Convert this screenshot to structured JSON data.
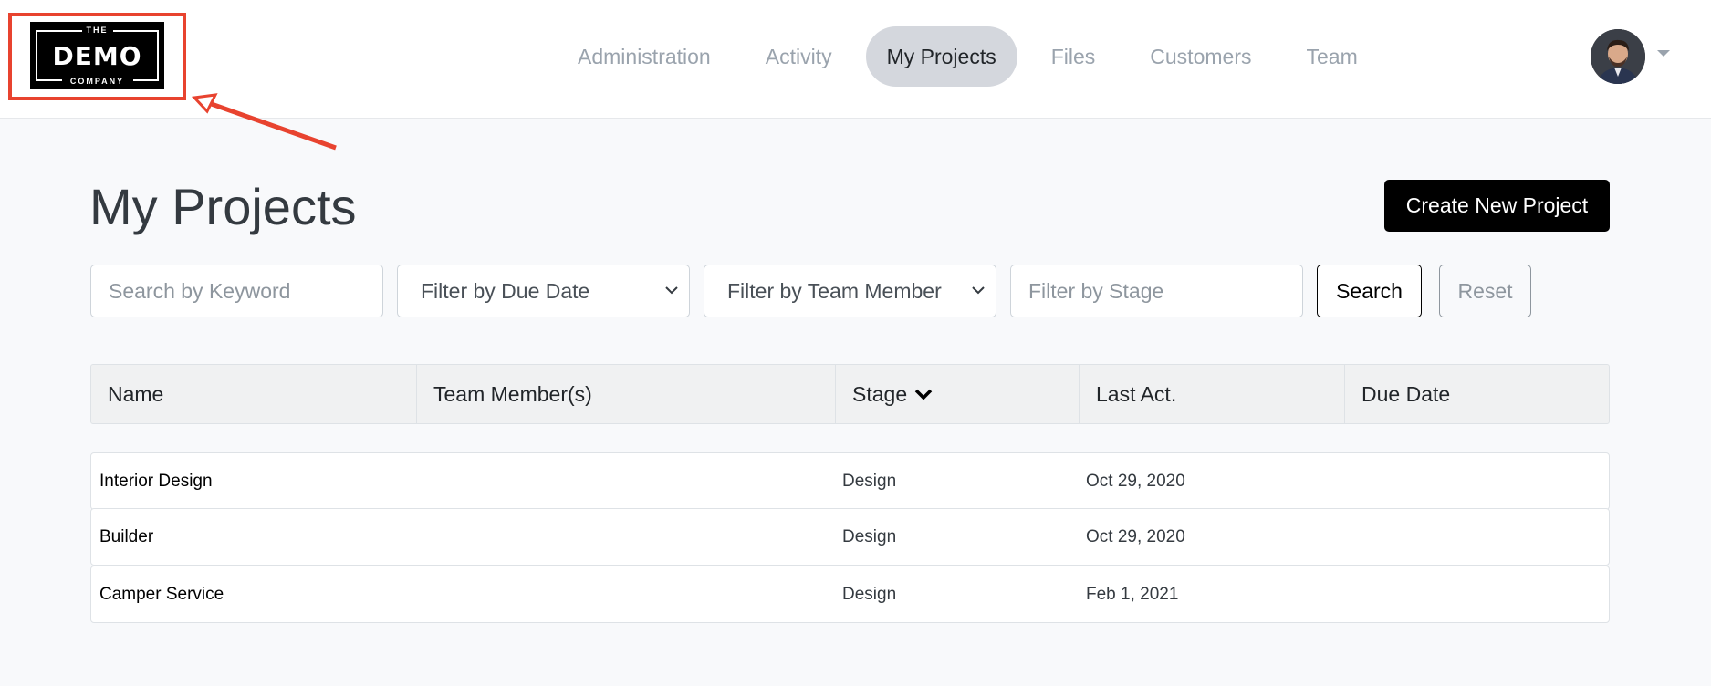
{
  "logo": {
    "line1": "THE",
    "line2": "DEMO",
    "line3": "COMPANY"
  },
  "nav": {
    "items": [
      {
        "label": "Administration",
        "name": "nav-administration",
        "active": false
      },
      {
        "label": "Activity",
        "name": "nav-activity",
        "active": false
      },
      {
        "label": "My Projects",
        "name": "nav-my-projects",
        "active": true
      },
      {
        "label": "Files",
        "name": "nav-files",
        "active": false
      },
      {
        "label": "Customers",
        "name": "nav-customers",
        "active": false
      },
      {
        "label": "Team",
        "name": "nav-team",
        "active": false
      }
    ]
  },
  "page": {
    "title": "My Projects",
    "create_label": "Create New Project"
  },
  "filters": {
    "keyword_placeholder": "Search by Keyword",
    "due_date_label": "Filter by Due Date",
    "team_member_label": "Filter by Team Member",
    "stage_placeholder": "Filter by Stage",
    "search_label": "Search",
    "reset_label": "Reset"
  },
  "table": {
    "headers": [
      "Name",
      "Team Member(s)",
      "Stage",
      "Last Act.",
      "Due Date"
    ],
    "rows": [
      {
        "name": "Interior Design",
        "team": "",
        "stage": "Design",
        "last": "Oct 29, 2020",
        "due": ""
      },
      {
        "name": "Builder",
        "team": "",
        "stage": "Design",
        "last": "Oct 29, 2020",
        "due": ""
      },
      {
        "name": "Camper Service",
        "team": "",
        "stage": "Design",
        "last": "Feb 1, 2021",
        "due": ""
      }
    ]
  },
  "colors": {
    "highlight": "#e8432f",
    "primary": "#000000",
    "nav_active_bg": "#d4d7dd"
  }
}
